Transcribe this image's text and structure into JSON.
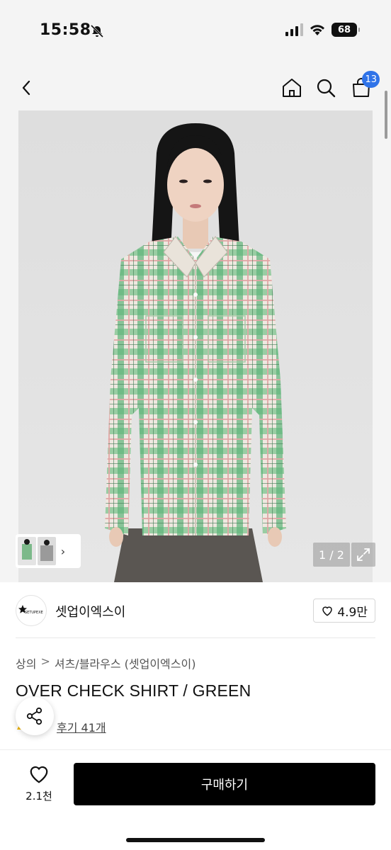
{
  "status_bar": {
    "time": "15:58",
    "battery": "68"
  },
  "nav": {
    "cart_count": "13"
  },
  "gallery": {
    "page_indicator": "1 / 2",
    "thumb_next": "›"
  },
  "brand": {
    "logo_text": "SETUPEXE",
    "name": "셋업이엑스이",
    "likes": "4.9만"
  },
  "breadcrumb": {
    "category": "상의",
    "separator": ">",
    "subcategory": "셔츠/블라우스 (셋업이엑스이)"
  },
  "product": {
    "title": "OVER CHECK SHIRT / GREEN",
    "review_link": "후기 41개"
  },
  "bottom_bar": {
    "wish_count": "2.1천",
    "buy_label": "구매하기"
  },
  "colors": {
    "accent_badge": "#2f73e8",
    "buy_button": "#000000",
    "shirt_green": "#5db47a"
  }
}
